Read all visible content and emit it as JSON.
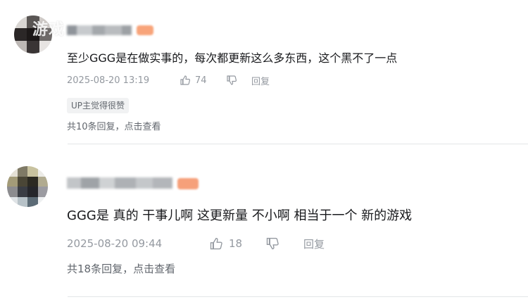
{
  "watermark": "游戏",
  "comments": [
    {
      "content": "至少GGG是在做实事的，每次都更新这么多东西，这个黑不了一点",
      "timestamp": "2025-08-20 13:19",
      "likes": "74",
      "reply_label": "回复",
      "up_tag": "UP主觉得很赞",
      "replies_summary": "共10条回复，点击查看",
      "icons": [
        "thumbs-up-icon",
        "thumbs-down-icon"
      ]
    },
    {
      "content": "GGG是 真的 干事儿啊 这更新量 不小啊 相当于一个 新的游戏",
      "timestamp": "2025-08-20 09:44",
      "likes": "18",
      "reply_label": "回复",
      "replies_summary": "共18条回复，点击查看",
      "icons": [
        "thumbs-up-icon",
        "thumbs-down-icon"
      ]
    }
  ],
  "colors": {
    "text": "#18191c",
    "meta": "#9499a0",
    "badge": "#f8a47a",
    "divider": "#e3e5e7"
  }
}
